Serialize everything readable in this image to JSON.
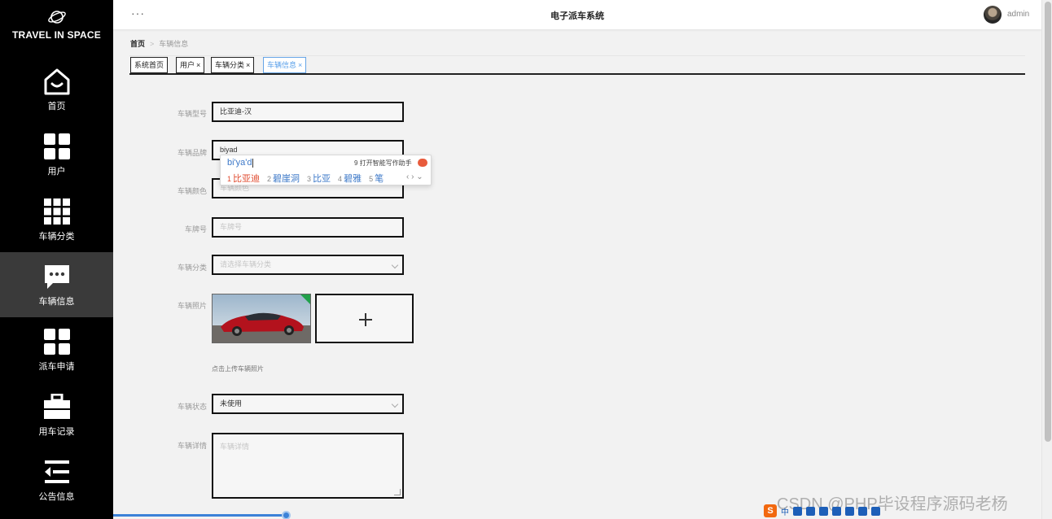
{
  "brand": {
    "name": "TRAVEL IN SPACE",
    "icon": "planet-icon"
  },
  "sidebar": {
    "items": [
      {
        "label": "首页",
        "icon": "home-icon",
        "active": false
      },
      {
        "label": "用户",
        "icon": "grid-icon",
        "active": false
      },
      {
        "label": "车辆分类",
        "icon": "apps-icon",
        "active": false
      },
      {
        "label": "车辆信息",
        "icon": "chat-icon",
        "active": true
      },
      {
        "label": "派车申请",
        "icon": "grid-icon",
        "active": false
      },
      {
        "label": "用车记录",
        "icon": "briefcase-icon",
        "active": false
      },
      {
        "label": "公告信息",
        "icon": "list-icon",
        "active": false
      }
    ]
  },
  "header": {
    "menu": "···",
    "title": "电子派车系统",
    "user": "admin"
  },
  "breadcrumb": {
    "home": "首页",
    "separator": ">",
    "current": "车辆信息"
  },
  "tabs": [
    {
      "label": "系统首页",
      "closable": false,
      "active": false
    },
    {
      "label": "用户",
      "closable": true,
      "active": false
    },
    {
      "label": "车辆分类",
      "closable": true,
      "active": false
    },
    {
      "label": "车辆信息",
      "closable": true,
      "active": true
    }
  ],
  "tab_close": "×",
  "form": {
    "model": {
      "label": "车辆型号",
      "value": "比亚迪-汉"
    },
    "brand": {
      "label": "车辆品牌",
      "value": "biyad"
    },
    "color": {
      "label": "车辆颜色",
      "placeholder": "车辆颜色"
    },
    "plate": {
      "label": "车牌号",
      "placeholder": "车牌号"
    },
    "category": {
      "label": "车辆分类",
      "placeholder": "请选择车辆分类"
    },
    "photo": {
      "label": "车辆照片",
      "hint": "点击上传车辆照片"
    },
    "status": {
      "label": "车辆状态",
      "value": "未使用"
    },
    "details": {
      "label": "车辆详情",
      "placeholder": "车辆详情"
    }
  },
  "ime": {
    "pinyin": "bi'ya'd",
    "assist": "9 打开智能写作助手",
    "candidates": [
      {
        "num": "1",
        "text": "比亚迪"
      },
      {
        "num": "2",
        "text": "碧崖洞"
      },
      {
        "num": "3",
        "text": "比亚"
      },
      {
        "num": "4",
        "text": "碧雅"
      },
      {
        "num": "5",
        "text": "笔"
      }
    ],
    "pager": "‹ › ⌄"
  },
  "ime_toolbar": {
    "logo": "S",
    "mode": "中"
  },
  "watermark": "CSDN @PHP毕设程序源码老杨",
  "colors": {
    "sidebar": "#000000",
    "active_tab": "#5aa0ea",
    "candidate_first": "#e04a2e",
    "candidate": "#3c78c8"
  }
}
